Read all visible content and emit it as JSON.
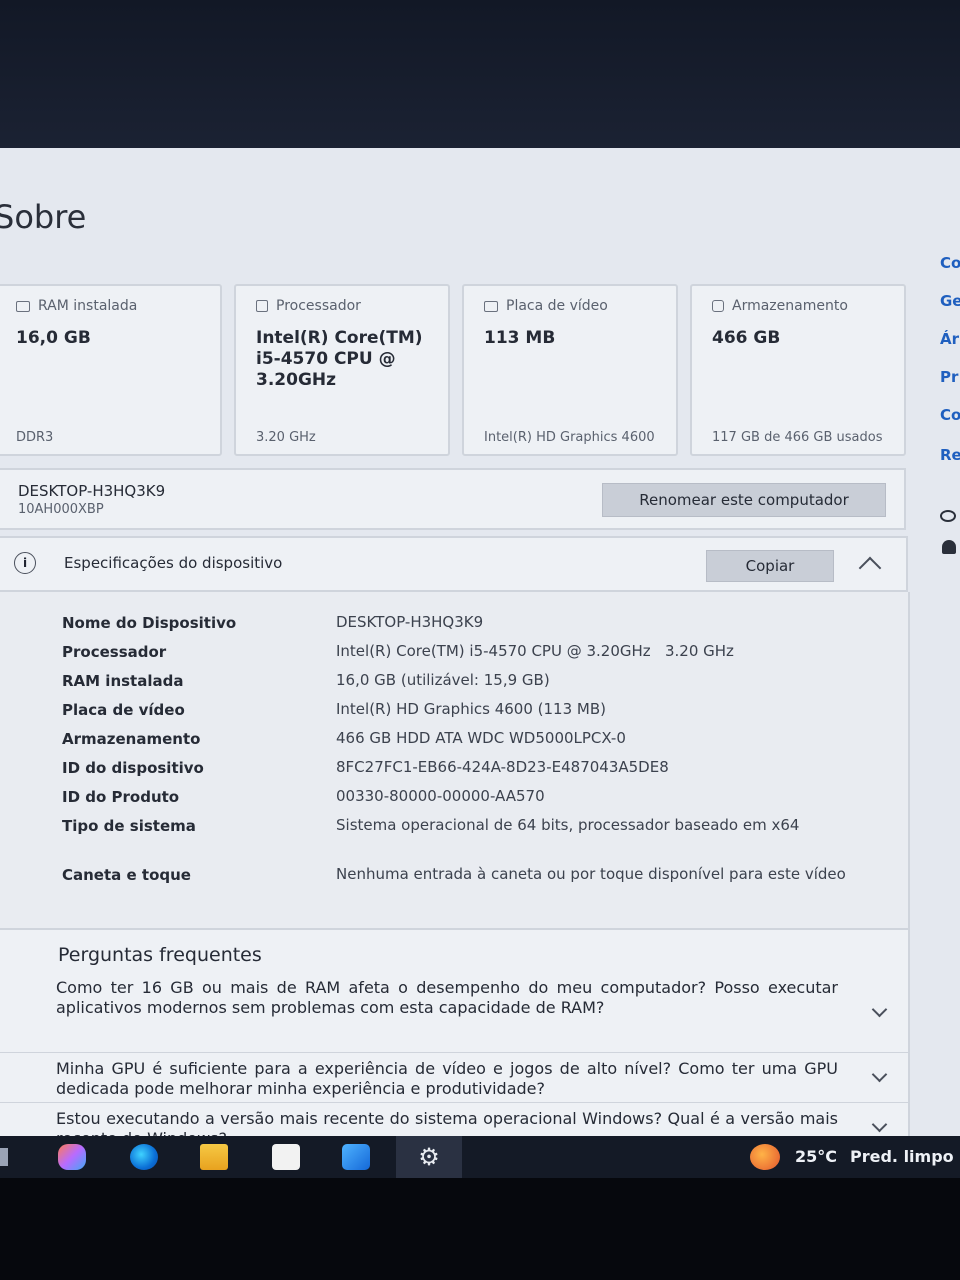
{
  "page": {
    "title": "Sobre"
  },
  "cards": [
    {
      "title": "RAM instalada",
      "value": "16,0 GB",
      "sub": "DDR3",
      "icon": "memory-icon"
    },
    {
      "title": "Processador",
      "value": "Intel(R) Core(TM) i5-4570 CPU @ 3.20GHz",
      "sub": "3.20 GHz",
      "icon": "processor-icon"
    },
    {
      "title": "Placa de vídeo",
      "value": "113 MB",
      "sub": "Intel(R) HD Graphics 4600",
      "icon": "display-icon"
    },
    {
      "title": "Armazenamento",
      "value": "466 GB",
      "sub": "117 GB de 466 GB usados",
      "icon": "storage-icon"
    }
  ],
  "device": {
    "name": "DESKTOP-H3HQ3K9",
    "model": "10AH000XBP",
    "rename_label": "Renomear este computador"
  },
  "specs": {
    "title": "Especificações do dispositivo",
    "copy_label": "Copiar",
    "rows": [
      {
        "label": "Nome do Dispositivo",
        "value": "DESKTOP-H3HQ3K9"
      },
      {
        "label": "Processador",
        "value": "Intel(R) Core(TM) i5-4570 CPU @ 3.20GHz   3.20 GHz"
      },
      {
        "label": "RAM instalada",
        "value": "16,0 GB (utilizável: 15,9 GB)"
      },
      {
        "label": "Placa de vídeo",
        "value": "Intel(R) HD Graphics 4600 (113 MB)"
      },
      {
        "label": "Armazenamento",
        "value": "466 GB HDD ATA WDC WD5000LPCX-0"
      },
      {
        "label": "ID do dispositivo",
        "value": "8FC27FC1-EB66-424A-8D23-E487043A5DE8"
      },
      {
        "label": "ID do Produto",
        "value": "00330-80000-00000-AA570"
      },
      {
        "label": "Tipo de sistema",
        "value": "Sistema operacional de 64 bits, processador baseado em x64"
      },
      {
        "label": "Caneta e toque",
        "value": "Nenhuma entrada à caneta ou por toque disponível para este vídeo"
      }
    ]
  },
  "faq": {
    "title": "Perguntas frequentes",
    "items": [
      {
        "question": "Como ter 16 GB ou mais de RAM afeta o desempenho do meu computador? Posso executar aplicativos modernos sem problemas com esta capacidade de RAM?"
      },
      {
        "question": "Minha GPU é suficiente para a experiência de vídeo e jogos de alto nível? Como ter uma GPU dedicada pode melhorar minha experiência e produtividade?"
      },
      {
        "question": "Estou executando a versão mais recente do sistema operacional Windows? Qual é a versão mais recente do Windows?"
      }
    ]
  },
  "right_nav": [
    "Co",
    "Ge",
    "Ár",
    "Pr",
    "Co",
    "Re"
  ],
  "taskbar": {
    "apps": [
      "copilot-icon",
      "edge-icon",
      "file-explorer-icon",
      "store-icon",
      "outlook-icon",
      "settings-icon"
    ],
    "temperature": "25°C",
    "weather": "Pred. limpo"
  }
}
